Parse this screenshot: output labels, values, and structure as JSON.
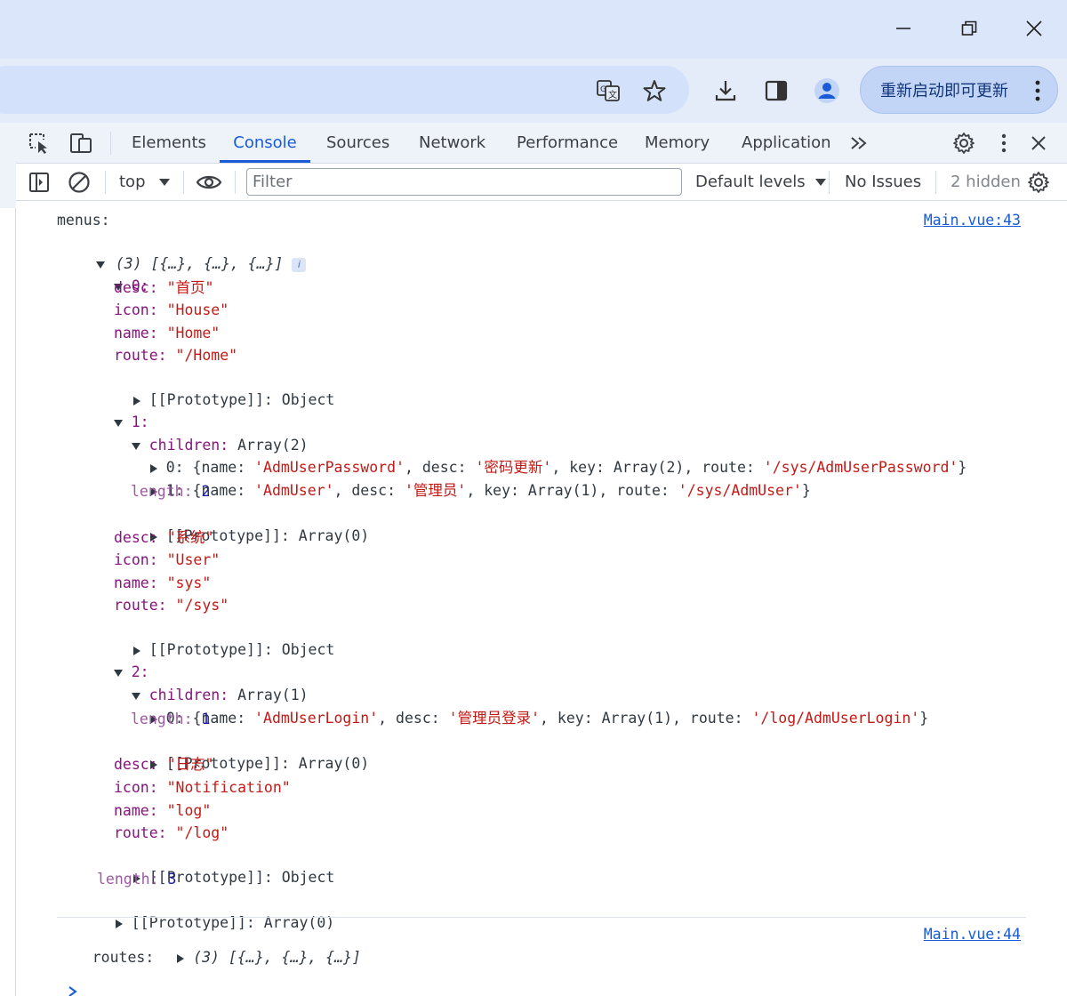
{
  "browser": {
    "update_label": "重新启动即可更新"
  },
  "devtools": {
    "tabs": [
      "Elements",
      "Console",
      "Sources",
      "Network",
      "Performance",
      "Memory",
      "Application"
    ],
    "active_tab": "Console"
  },
  "console_toolbar": {
    "context": "top",
    "filter_placeholder": "Filter",
    "levels": "Default levels",
    "issues": "No Issues",
    "hidden": "2 hidden"
  },
  "log1": {
    "label": "menus:",
    "source": "Main.vue:43",
    "summary": "(3) [{…}, {…}, {…}]",
    "items": [
      {
        "index": "0:",
        "desc_key": "desc:",
        "desc": "\"首页\"",
        "icon_key": "icon:",
        "icon": "\"House\"",
        "name_key": "name:",
        "name": "\"Home\"",
        "route_key": "route:",
        "route": "\"/Home\"",
        "proto": "[[Prototype]]: Object"
      },
      {
        "index": "1:",
        "children_key": "children:",
        "children": "Array(2)",
        "children_items": [
          {
            "pre": "0: {name: ",
            "name": "'AdmUserPassword'",
            "mid1": ", desc: ",
            "desc": "'密码更新'",
            "mid2": ", key: Array(2), route: ",
            "route": "'/sys/AdmUserPassword'",
            "post": "}"
          },
          {
            "pre": "1: {name: ",
            "name": "'AdmUser'",
            "mid1": ", desc: ",
            "desc": "'管理员'",
            "mid2": ", key: Array(1), route: ",
            "route": "'/sys/AdmUser'",
            "post": "}"
          }
        ],
        "length_key": "length:",
        "length": "2",
        "children_proto": "[[Prototype]]: Array(0)",
        "desc_key": "desc:",
        "desc": "\"系统\"",
        "icon_key": "icon:",
        "icon": "\"User\"",
        "name_key": "name:",
        "name": "\"sys\"",
        "route_key": "route:",
        "route": "\"/sys\"",
        "proto": "[[Prototype]]: Object"
      },
      {
        "index": "2:",
        "children_key": "children:",
        "children": "Array(1)",
        "children_items": [
          {
            "pre": "0: {name: ",
            "name": "'AdmUserLogin'",
            "mid1": ", desc: ",
            "desc": "'管理员登录'",
            "mid2": ", key: Array(1), route: ",
            "route": "'/log/AdmUserLogin'",
            "post": "}"
          }
        ],
        "length_key": "length:",
        "length": "1",
        "children_proto": "[[Prototype]]: Array(0)",
        "desc_key": "desc:",
        "desc": "\"日志\"",
        "icon_key": "icon:",
        "icon": "\"Notification\"",
        "name_key": "name:",
        "name": "\"log\"",
        "route_key": "route:",
        "route": "\"/log\"",
        "proto": "[[Prototype]]: Object"
      }
    ],
    "length_key": "length:",
    "length": "3",
    "proto": "[[Prototype]]: Array(0)"
  },
  "log2": {
    "label": "routes:",
    "summary": "(3) [{…}, {…}, {…}]",
    "source": "Main.vue:44"
  },
  "colors": {
    "accent": "#1a5bd8",
    "key": "#881280",
    "string": "#c41a16",
    "number": "#1a1aa6"
  }
}
